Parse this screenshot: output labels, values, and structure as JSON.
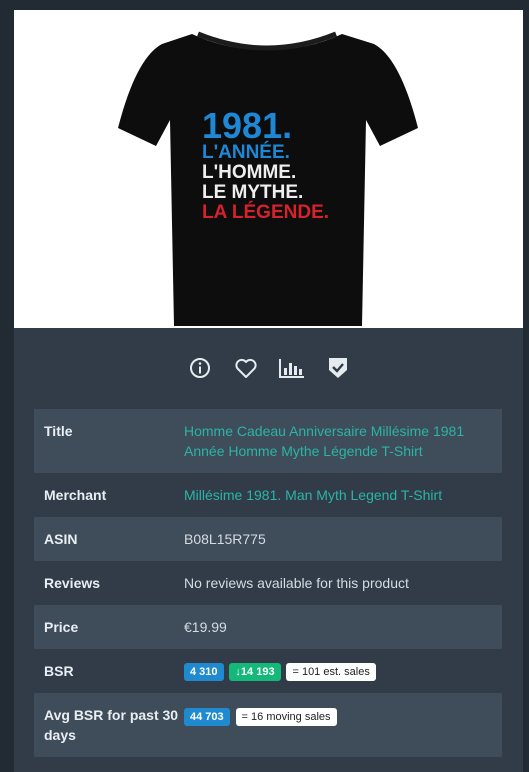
{
  "product": {
    "image": {
      "line1": "1981.",
      "line2": "L'ANNÉE.",
      "line3": "L'HOMME.",
      "line4": "LE MYTHE.",
      "line5": "LA LÉGENDE."
    },
    "icons": [
      "info-icon",
      "heart-icon",
      "bar-chart-icon",
      "shield-check-icon"
    ]
  },
  "details": {
    "title_label": "Title",
    "title_value": "Homme Cadeau Anniversaire Millésime 1981 Année Homme Mythe Légende T-Shirt",
    "merchant_label": "Merchant",
    "merchant_value": "Millésime 1981. Man Myth Legend T-Shirt",
    "asin_label": "ASIN",
    "asin_value": "B08L15R775",
    "reviews_label": "Reviews",
    "reviews_value": "No reviews available for this product",
    "price_label": "Price",
    "price_value": "€19.99",
    "bsr_label": "BSR",
    "bsr_current": "4 310",
    "bsr_best": "14 193",
    "bsr_sales": "= 101 est. sales",
    "avg_label": "Avg BSR for past 30 days",
    "avg_value": "44 703",
    "avg_sales": "= 16 moving sales"
  },
  "colors": {
    "blue": "#1f8ad0",
    "green": "#14b97a",
    "link": "#2bb5a6",
    "shirt_blue": "#1e88d6",
    "shirt_red": "#d6222a"
  }
}
